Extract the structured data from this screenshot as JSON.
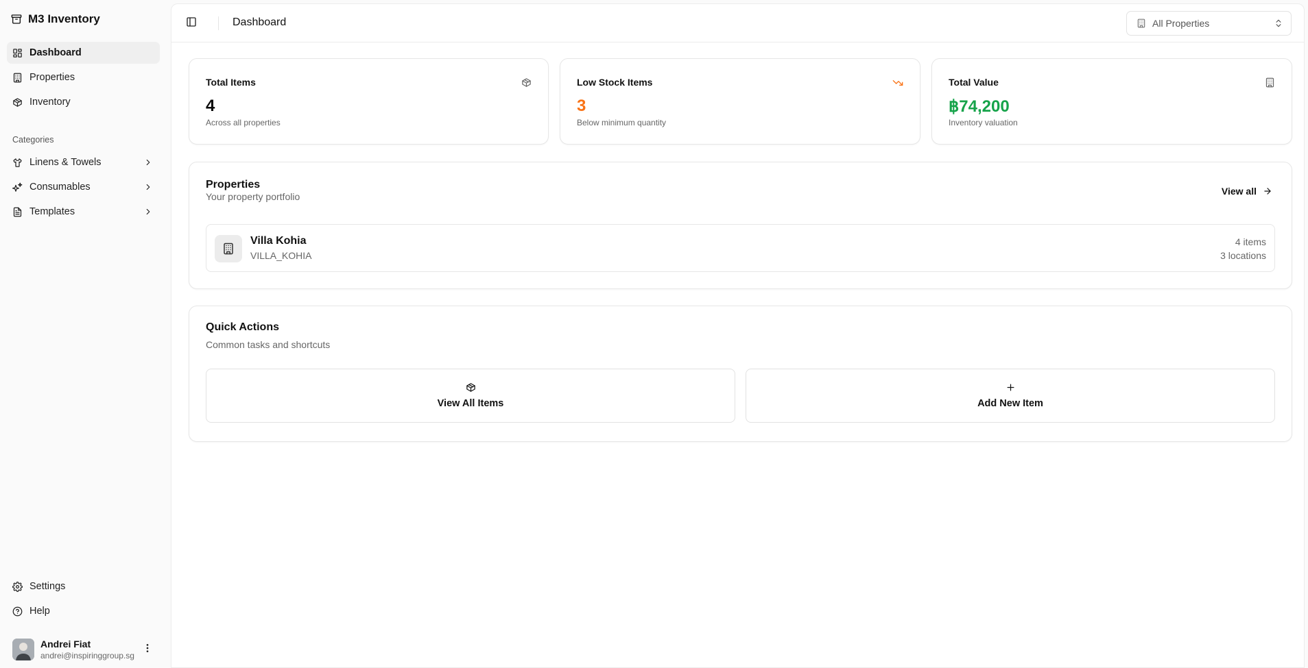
{
  "app": {
    "title": "M3 Inventory"
  },
  "sidebar": {
    "nav": [
      {
        "label": "Dashboard",
        "icon": "layout-grid-icon",
        "active": true
      },
      {
        "label": "Properties",
        "icon": "building-icon"
      },
      {
        "label": "Inventory",
        "icon": "package-icon"
      }
    ],
    "categories_label": "Categories",
    "categories": [
      {
        "label": "Linens & Towels",
        "icon": "shirt-icon"
      },
      {
        "label": "Consumables",
        "icon": "sparkles-icon"
      },
      {
        "label": "Templates",
        "icon": "file-text-icon"
      }
    ],
    "footer": [
      {
        "label": "Settings",
        "icon": "gear-icon"
      },
      {
        "label": "Help",
        "icon": "help-circle-icon"
      }
    ],
    "user": {
      "name": "Andrei Fiat",
      "email": "andrei@inspiringgroup.sg"
    }
  },
  "header": {
    "title": "Dashboard",
    "property_select": {
      "value": "All Properties"
    }
  },
  "stats": [
    {
      "title": "Total Items",
      "value": "4",
      "sub": "Across all properties",
      "color": "#0a0a0a",
      "icon": "package-icon"
    },
    {
      "title": "Low Stock Items",
      "value": "3",
      "sub": "Below minimum quantity",
      "color": "#f97316",
      "icon": "trending-down-icon"
    },
    {
      "title": "Total Value",
      "value": "฿74,200",
      "sub": "Inventory valuation",
      "color": "#16a34a",
      "icon": "building-icon"
    }
  ],
  "properties": {
    "title": "Properties",
    "subtitle": "Your property portfolio",
    "view_all": "View all",
    "items": [
      {
        "name": "Villa Kohia",
        "code": "VILLA_KOHIA",
        "items": "4 items",
        "locations": "3 locations"
      }
    ]
  },
  "quick_actions": {
    "title": "Quick Actions",
    "subtitle": "Common tasks and shortcuts",
    "actions": [
      {
        "label": "View All Items",
        "icon": "package-icon"
      },
      {
        "label": "Add New Item",
        "icon": "plus-icon"
      }
    ]
  },
  "colors": {
    "accent_orange": "#f97316",
    "accent_green": "#16a34a"
  }
}
